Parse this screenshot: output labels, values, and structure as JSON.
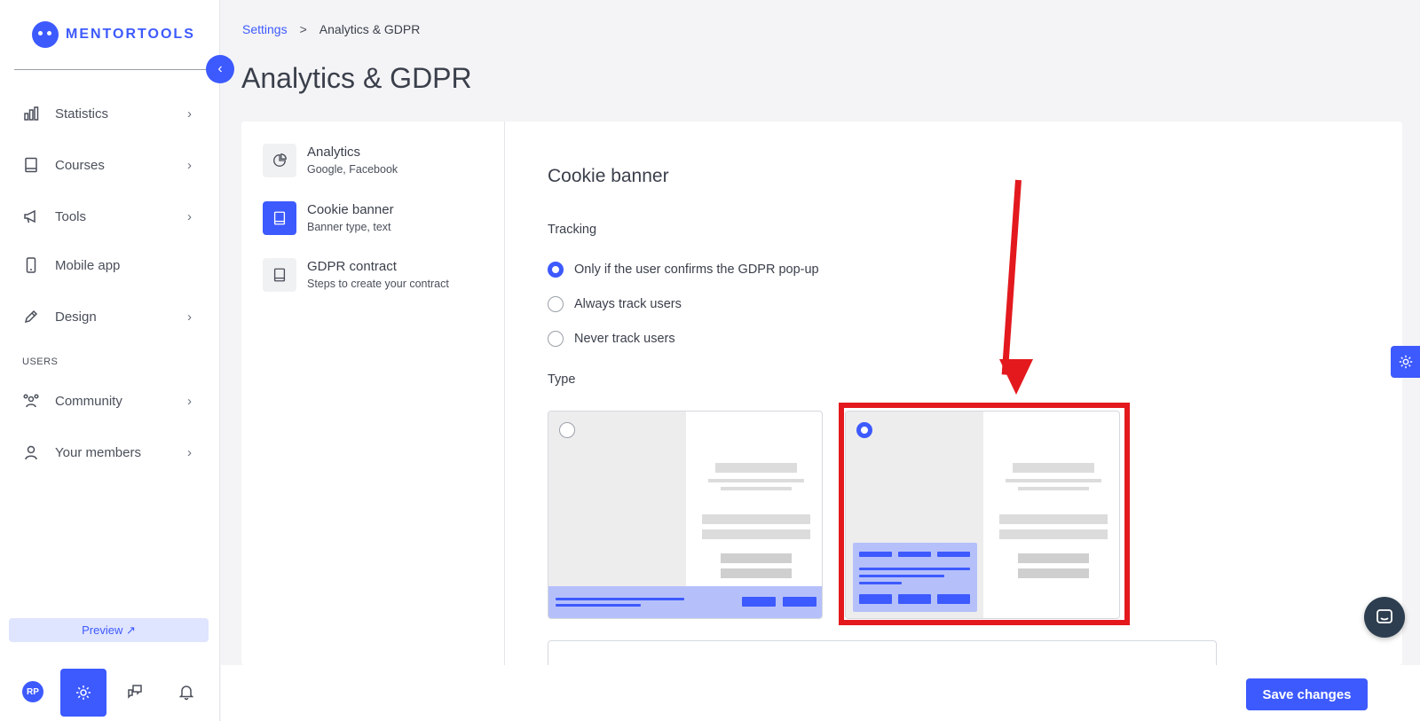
{
  "brand": {
    "name": "MENTORTOOLS"
  },
  "sidebar": {
    "items": [
      {
        "label": "Statistics",
        "icon": "bar-chart-icon"
      },
      {
        "label": "Courses",
        "icon": "book-icon"
      },
      {
        "label": "Tools",
        "icon": "megaphone-icon"
      },
      {
        "label": "Mobile app",
        "icon": "mobile-icon"
      },
      {
        "label": "Design",
        "icon": "pencil-icon"
      }
    ],
    "users_section_label": "USERS",
    "users_items": [
      {
        "label": "Community",
        "icon": "community-icon"
      },
      {
        "label": "Your members",
        "icon": "user-icon"
      }
    ],
    "preview_label": "Preview ↗",
    "avatar_initials": "RP"
  },
  "breadcrumb": {
    "parent": "Settings",
    "separator": ">",
    "current": "Analytics & GDPR"
  },
  "page_title": "Analytics & GDPR",
  "subnav": [
    {
      "title": "Analytics",
      "desc": "Google, Facebook",
      "icon": "pie-chart-icon"
    },
    {
      "title": "Cookie banner",
      "desc": "Banner type, text",
      "icon": "document-icon"
    },
    {
      "title": "GDPR contract",
      "desc": "Steps to create your contract",
      "icon": "contract-icon"
    }
  ],
  "content": {
    "section_title": "Cookie banner",
    "tracking": {
      "label": "Tracking",
      "options": [
        "Only if the user confirms the GDPR pop-up",
        "Always track users",
        "Never track users"
      ],
      "selected_index": 0
    },
    "type": {
      "label": "Type",
      "options": [
        "bottom-bar-banner",
        "corner-popup-banner"
      ],
      "selected_index": 1
    }
  },
  "footer": {
    "save_label": "Save changes"
  },
  "colors": {
    "accent": "#3d5afe",
    "annotation": "#e3191e",
    "chat": "#2d3e50"
  }
}
